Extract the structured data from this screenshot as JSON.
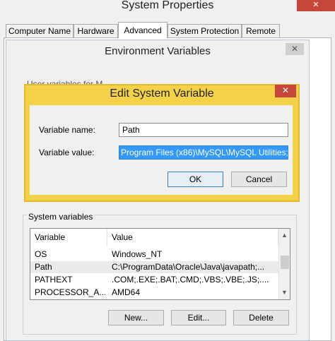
{
  "system_properties": {
    "title": "System Properties",
    "tabs": [
      {
        "label": "Computer Name"
      },
      {
        "label": "Hardware"
      },
      {
        "label": "Advanced"
      },
      {
        "label": "System Protection"
      },
      {
        "label": "Remote"
      }
    ],
    "active_tab": "Advanced",
    "close_glyph": "✕"
  },
  "environment_variables": {
    "title": "Environment Variables",
    "close_glyph": "✕",
    "user_variables_label": "User variables for M...",
    "system_variables": {
      "label": "System variables",
      "columns": [
        "Variable",
        "Value"
      ],
      "rows": [
        {
          "variable": "OS",
          "value": "Windows_NT"
        },
        {
          "variable": "Path",
          "value": "C:\\ProgramData\\Oracle\\Java\\javapath;..."
        },
        {
          "variable": "PATHEXT",
          "value": ".COM;.EXE;.BAT;.CMD;.VBS;.VBE;.JS;...."
        },
        {
          "variable": "PROCESSOR_A...",
          "value": "AMD64"
        }
      ],
      "selected_row": "Path",
      "new_label": "New...",
      "edit_label": "Edit...",
      "delete_label": "Delete",
      "scroll_up_glyph": "▲",
      "scroll_down_glyph": "▼"
    }
  },
  "edit_dialog": {
    "title": "Edit System Variable",
    "close_glyph": "✕",
    "variable_name_label": "Variable name:",
    "variable_name_value": "Path",
    "variable_value_label": "Variable value:",
    "variable_value_value": "Program Files (x86)\\MySQL\\MySQL Utilities;",
    "ok_label": "OK",
    "cancel_label": "Cancel",
    "accent_color": "#f3d24a",
    "selection_color": "#3399ff"
  }
}
